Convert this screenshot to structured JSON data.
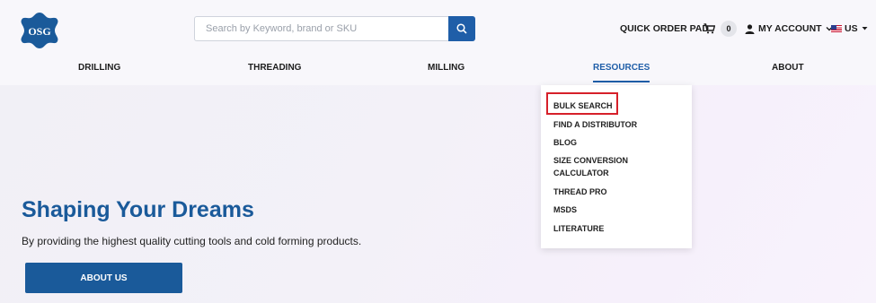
{
  "header": {
    "logo_text": "OSG",
    "search": {
      "placeholder": "Search by Keyword, brand or SKU",
      "value": ""
    },
    "quick_order_label": "QUICK ORDER PAD",
    "cart_count": "0",
    "account_label": "MY ACCOUNT",
    "locale_label": "US"
  },
  "nav": {
    "items": [
      {
        "label": "DRILLING"
      },
      {
        "label": "THREADING"
      },
      {
        "label": "MILLING"
      },
      {
        "label": "RESOURCES",
        "active": true
      },
      {
        "label": "ABOUT"
      }
    ]
  },
  "dropdown": {
    "items": [
      {
        "label": "BULK SEARCH",
        "highlighted": true
      },
      {
        "label": "FIND A DISTRIBUTOR"
      },
      {
        "label": "BLOG"
      },
      {
        "label": "SIZE CONVERSION"
      },
      {
        "label": "CALCULATOR"
      },
      {
        "label": "THREAD PRO"
      },
      {
        "label": "MSDS"
      },
      {
        "label": "LITERATURE"
      }
    ]
  },
  "hero": {
    "title": "Shaping Your Dreams",
    "subtitle": "By providing the highest quality cutting tools and cold forming products.",
    "button_label": "ABOUT US"
  },
  "colors": {
    "brand_blue": "#1a5a9a",
    "highlight_red": "#d6202a"
  },
  "icons": [
    "logo-icon",
    "search-icon",
    "cart-icon",
    "user-icon",
    "chevron-down-icon",
    "us-flag-icon",
    "caret-down-icon"
  ]
}
